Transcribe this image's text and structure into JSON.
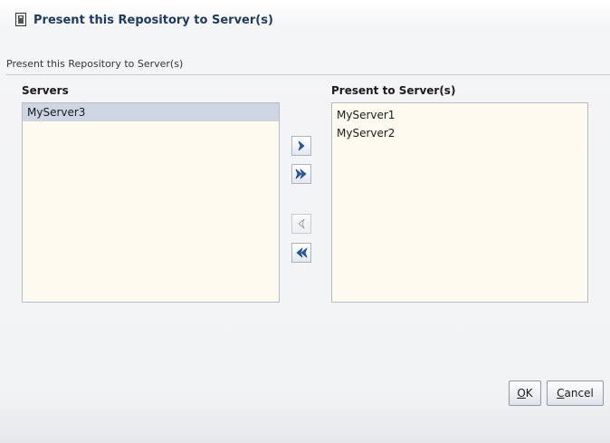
{
  "dialog": {
    "title": "Present this Repository to Server(s)",
    "section_label": "Present this Repository to Server(s)"
  },
  "available": {
    "header": "Servers",
    "items": [
      {
        "label": "MyServer3",
        "selected": true
      }
    ]
  },
  "selected_list": {
    "header": "Present to Server(s)",
    "items": [
      {
        "label": "MyServer1",
        "selected": false
      },
      {
        "label": "MyServer2",
        "selected": false
      }
    ]
  },
  "shuttle": {
    "move": {
      "icon": "chevron-right-icon",
      "enabled": true
    },
    "move_all": {
      "icon": "double-chevron-right-icon",
      "enabled": true
    },
    "remove": {
      "icon": "chevron-left-icon",
      "enabled": false
    },
    "remove_all": {
      "icon": "double-chevron-left-icon",
      "enabled": true
    }
  },
  "buttons": {
    "ok": {
      "access_key": "O",
      "rest": "K"
    },
    "cancel": {
      "access_key": "C",
      "rest": "ancel"
    }
  },
  "colors": {
    "accent": "#1f5fb5",
    "title_text": "#1d3a5f",
    "list_background": "#fdfbf0",
    "selection": "#cfd6e3"
  }
}
